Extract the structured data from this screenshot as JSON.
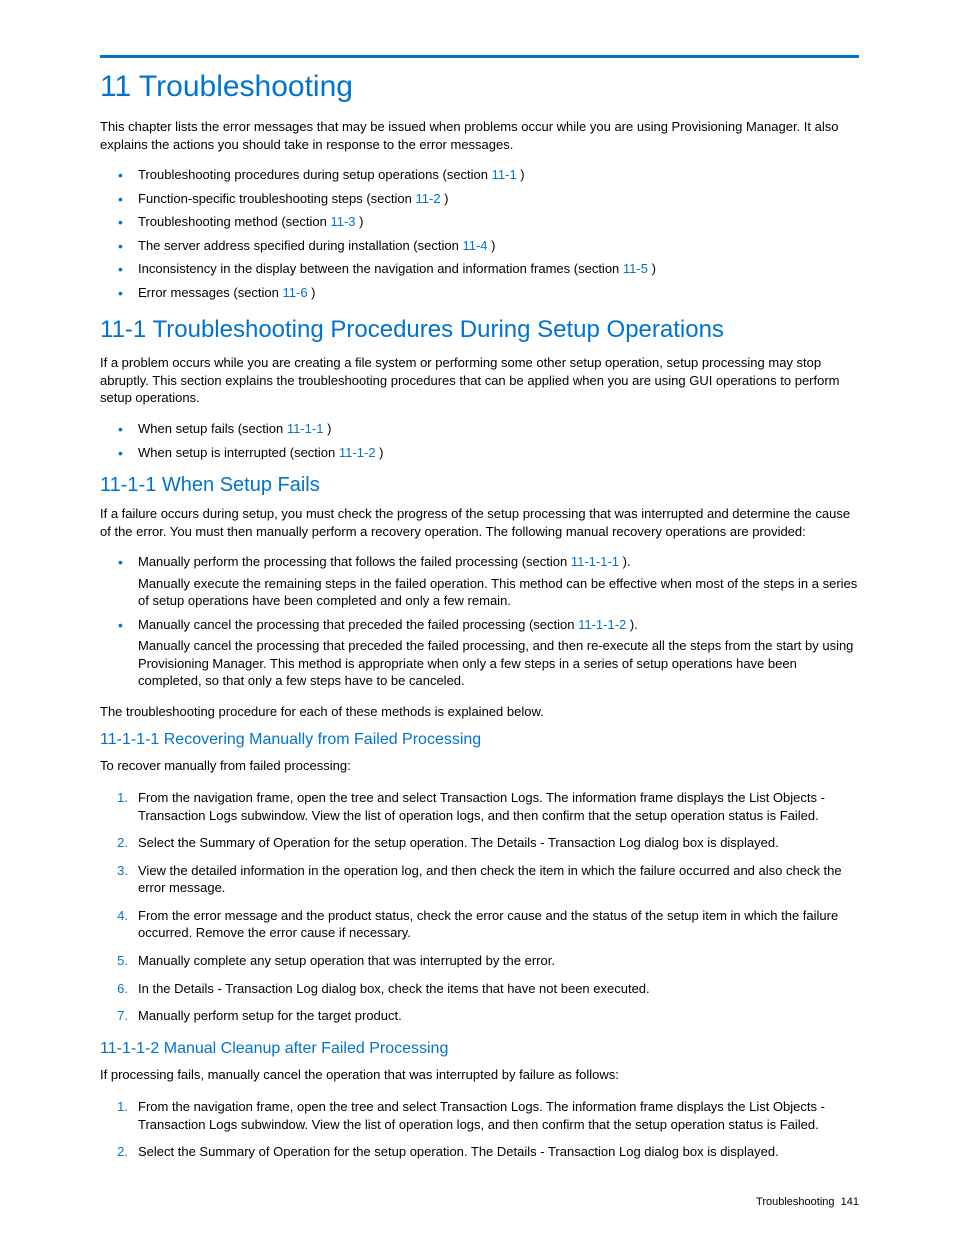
{
  "h1": "11 Troubleshooting",
  "intro": "This chapter lists the error messages that may be issued when problems occur while you are using Provisioning Manager. It also explains the actions you should take in response to the error messages.",
  "toc": [
    {
      "pre": "Troubleshooting procedures during setup operations (section ",
      "link": "11-1",
      "post": " )"
    },
    {
      "pre": "Function-specific troubleshooting steps (section ",
      "link": "11-2",
      "post": " )"
    },
    {
      "pre": "Troubleshooting method (section ",
      "link": "11-3",
      "post": " )"
    },
    {
      "pre": "The server address specified during installation (section ",
      "link": "11-4",
      "post": " )"
    },
    {
      "pre": "Inconsistency in the display between the navigation and information frames (section ",
      "link": "11-5",
      "post": " )"
    },
    {
      "pre": "Error messages (section ",
      "link": "11-6",
      "post": " )"
    }
  ],
  "s11_1": {
    "title": "11-1 Troubleshooting Procedures During Setup Operations",
    "intro": "If a problem occurs while you are creating a file system or performing some other setup operation, setup processing may stop abruptly. This section explains the troubleshooting procedures that can be applied when you are using GUI operations to perform setup operations.",
    "sub": [
      {
        "pre": "When setup fails (section ",
        "link": "11-1-1",
        "post": " )"
      },
      {
        "pre": "When setup is interrupted (section ",
        "link": "11-1-2",
        "post": " )"
      }
    ]
  },
  "s11_1_1": {
    "title": "11-1-1 When Setup Fails",
    "intro": "If a failure occurs during setup, you must check the progress of the setup processing that was interrupted and determine the cause of the error. You must then manually perform a recovery operation. The following manual recovery operations are provided:",
    "bul": [
      {
        "pre": "Manually perform the processing that follows the failed processing (section ",
        "link": "11-1-1-1",
        "post": " ).",
        "ext": "Manually execute the remaining steps in the failed operation. This method can be effective when most of the steps in a series of setup operations have been completed and only a few remain."
      },
      {
        "pre": "Manually cancel the processing that preceded the failed processing (section ",
        "link": "11-1-1-2",
        "post": " ).",
        "ext": "Manually cancel the processing that preceded the failed processing, and then re-execute all the steps from the start by using Provisioning Manager. This method is appropriate when only a few steps in a series of setup operations have been completed, so that only a few steps have to be canceled."
      }
    ],
    "outro": "The troubleshooting procedure for each of these methods is explained below."
  },
  "s11_1_1_1": {
    "title": "11-1-1-1 Recovering Manually from Failed Processing",
    "intro": "To recover manually from failed processing:",
    "steps": [
      "From the navigation frame, open the tree and select Transaction Logs. The information frame displays the List Objects - Transaction Logs subwindow. View the list of operation logs, and then confirm that the setup operation status is Failed.",
      "Select the Summary of Operation for the setup operation. The Details - Transaction Log dialog box is displayed.",
      "View the detailed information in the operation log, and then check the item in which the failure occurred and also check the error message.",
      "From the error message and the product status, check the error cause and the status of the setup item in which the failure occurred. Remove the error cause if necessary.",
      "Manually complete any setup operation that was interrupted by the error.",
      "In the Details - Transaction Log dialog box, check the items that have not been executed.",
      "Manually perform setup for the target product."
    ]
  },
  "s11_1_1_2": {
    "title": "11-1-1-2 Manual Cleanup after Failed Processing",
    "intro": "If processing fails, manually cancel the operation that was interrupted by failure as follows:",
    "steps": [
      "From the navigation frame, open the tree and select Transaction Logs. The information frame displays the List Objects - Transaction Logs subwindow. View the list of operation logs, and then confirm that the setup operation status is Failed.",
      "Select the Summary of Operation for the setup operation. The Details - Transaction Log dialog box is displayed."
    ]
  },
  "footer": {
    "label": "Troubleshooting",
    "page": "141"
  }
}
